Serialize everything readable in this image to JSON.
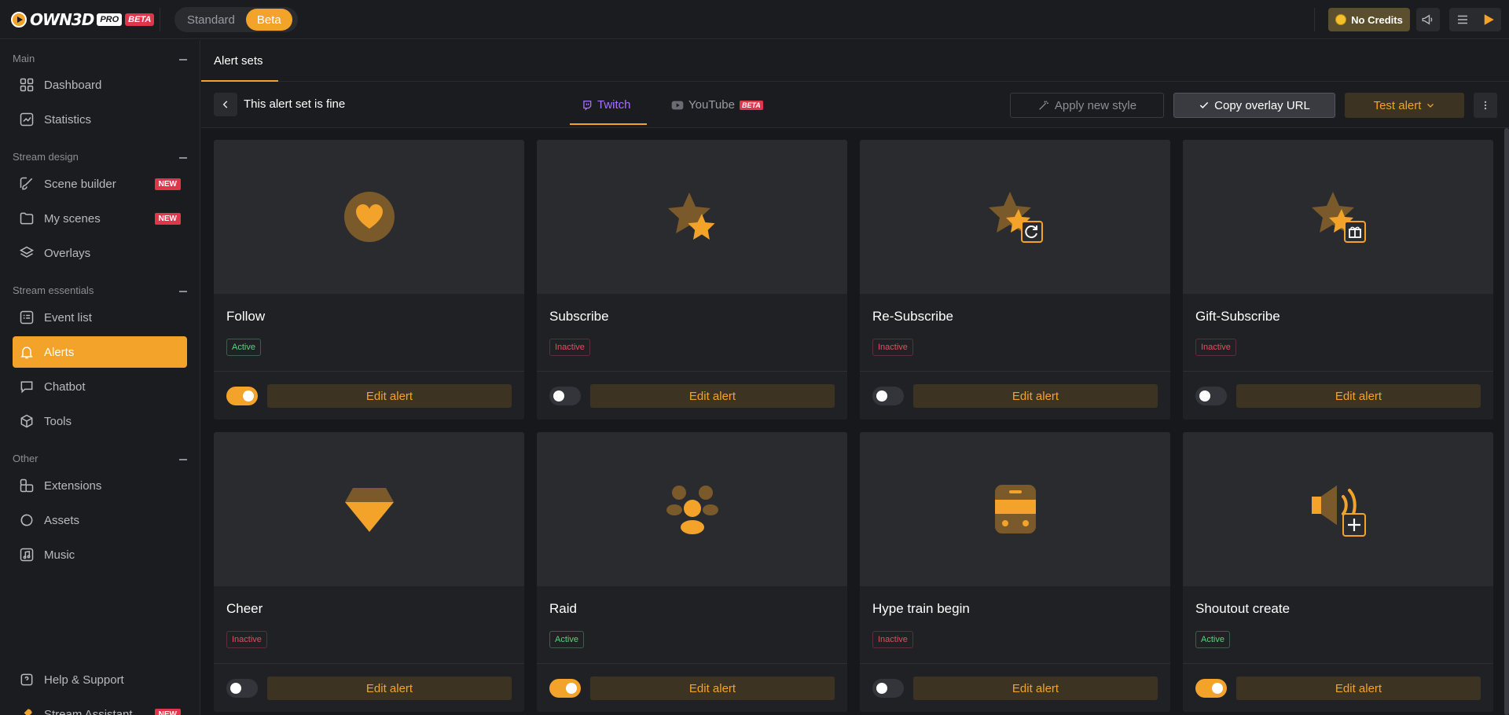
{
  "brand": {
    "logo_text": "OWN3D",
    "pro": "PRO",
    "beta": "BETA"
  },
  "mode_switch": {
    "options": [
      "Standard",
      "Beta"
    ],
    "selected": "Beta"
  },
  "topbar": {
    "credits_label": "No Credits"
  },
  "sidebar": {
    "sections": [
      {
        "title": "Main",
        "items": [
          {
            "label": "Dashboard"
          },
          {
            "label": "Statistics"
          }
        ]
      },
      {
        "title": "Stream design",
        "items": [
          {
            "label": "Scene builder",
            "badge": "NEW"
          },
          {
            "label": "My scenes",
            "badge": "NEW"
          },
          {
            "label": "Overlays"
          }
        ]
      },
      {
        "title": "Stream essentials",
        "items": [
          {
            "label": "Event list"
          },
          {
            "label": "Alerts"
          },
          {
            "label": "Chatbot"
          },
          {
            "label": "Tools"
          }
        ]
      },
      {
        "title": "Other",
        "items": [
          {
            "label": "Extensions"
          },
          {
            "label": "Assets"
          },
          {
            "label": "Music"
          }
        ]
      }
    ],
    "active_item": "Alerts",
    "footer": [
      {
        "label": "Help & Support"
      },
      {
        "label": "Stream Assistant",
        "badge": "NEW"
      }
    ]
  },
  "main": {
    "tab": "Alert sets",
    "alert_set_title": "This alert set is fine",
    "platforms": [
      {
        "label": "Twitch"
      },
      {
        "label": "YouTube",
        "badge": "BETA"
      }
    ],
    "active_platform": "Twitch",
    "actions": {
      "apply_style": "Apply new style",
      "copy_url": "Copy overlay URL",
      "test_alert": "Test alert"
    },
    "edit_label": "Edit alert",
    "alerts": [
      {
        "title": "Follow",
        "status": "Active",
        "enabled": true,
        "icon": "heart-icon"
      },
      {
        "title": "Subscribe",
        "status": "Inactive",
        "enabled": false,
        "icon": "star-icon"
      },
      {
        "title": "Re-Subscribe",
        "status": "Inactive",
        "enabled": false,
        "icon": "star-refresh-icon"
      },
      {
        "title": "Gift-Subscribe",
        "status": "Inactive",
        "enabled": false,
        "icon": "star-gift-icon"
      },
      {
        "title": "Cheer",
        "status": "Inactive",
        "enabled": false,
        "icon": "gem-icon"
      },
      {
        "title": "Raid",
        "status": "Active",
        "enabled": true,
        "icon": "people-icon"
      },
      {
        "title": "Hype train begin",
        "status": "Inactive",
        "enabled": false,
        "icon": "train-icon"
      },
      {
        "title": "Shoutout create",
        "status": "Active",
        "enabled": true,
        "icon": "speaker-plus-icon"
      }
    ]
  },
  "colors": {
    "accent": "#f3a32a",
    "twitch": "#a970ff",
    "active": "#5cd17a",
    "inactive": "#e0505f",
    "badge": "#e0364c"
  }
}
